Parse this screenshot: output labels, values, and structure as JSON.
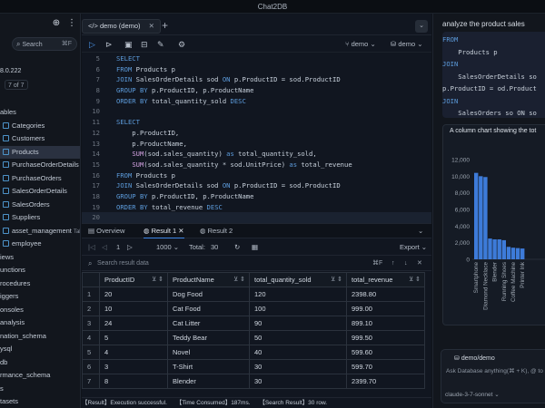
{
  "app": {
    "title": "Chat2DB"
  },
  "sidebar": {
    "search": {
      "placeholder": "Search",
      "shortcut": "⌘F"
    },
    "version": "8.0.222",
    "count": "7 of 7",
    "items": [
      {
        "label": "ables",
        "kind": "folder"
      },
      {
        "label": "Categories",
        "kind": "table"
      },
      {
        "label": "Customers",
        "kind": "table"
      },
      {
        "label": "Products",
        "kind": "table",
        "selected": true
      },
      {
        "label": "PurchaseOrderDetails",
        "kind": "table"
      },
      {
        "label": "PurchaseOrders",
        "kind": "table"
      },
      {
        "label": "SalesOrderDetails",
        "kind": "table"
      },
      {
        "label": "SalesOrders",
        "kind": "table"
      },
      {
        "label": "Suppliers",
        "kind": "table"
      },
      {
        "label": "asset_management",
        "kind": "table",
        "tag": "Tab"
      },
      {
        "label": "employee",
        "kind": "table"
      },
      {
        "label": "iews",
        "kind": "folder"
      },
      {
        "label": "unctions",
        "kind": "folder"
      },
      {
        "label": "rocedures",
        "kind": "folder"
      },
      {
        "label": "iggers",
        "kind": "folder"
      },
      {
        "label": "onsoles",
        "kind": "folder"
      },
      {
        "label": "analysis",
        "kind": "folder"
      },
      {
        "label": "nation_schema",
        "kind": "folder"
      },
      {
        "label": "ysql",
        "kind": "folder"
      },
      {
        "label": "db",
        "kind": "folder"
      },
      {
        "label": "rmance_schema",
        "kind": "folder"
      },
      {
        "label": "s",
        "kind": "folder"
      },
      {
        "label": "tasets",
        "kind": "folder"
      }
    ]
  },
  "editor": {
    "tab": {
      "label": "demo (demo)",
      "icon": "code-icon"
    },
    "toolbar": {
      "datasource": "demo",
      "database": "demo"
    },
    "lines": [
      {
        "n": "5",
        "tokens": [
          {
            "t": "SELECT",
            "c": "kw"
          }
        ]
      },
      {
        "n": "6",
        "tokens": [
          {
            "t": "FROM",
            "c": "kw"
          },
          {
            "t": " Products p",
            "c": ""
          }
        ]
      },
      {
        "n": "7",
        "tokens": [
          {
            "t": "JOIN",
            "c": "kw"
          },
          {
            "t": " SalesOrderDetails sod ",
            "c": ""
          },
          {
            "t": "ON",
            "c": "kw"
          },
          {
            "t": " p.ProductID = sod.ProductID",
            "c": ""
          }
        ]
      },
      {
        "n": "8",
        "tokens": [
          {
            "t": "GROUP BY",
            "c": "kw"
          },
          {
            "t": " p.ProductID, p.ProductName",
            "c": ""
          }
        ]
      },
      {
        "n": "9",
        "tokens": [
          {
            "t": "ORDER BY",
            "c": "kw"
          },
          {
            "t": " total_quantity_sold ",
            "c": ""
          },
          {
            "t": "DESC",
            "c": "kw"
          }
        ]
      },
      {
        "n": "10",
        "tokens": []
      },
      {
        "n": "11",
        "tokens": [
          {
            "t": "SELECT",
            "c": "kw"
          }
        ]
      },
      {
        "n": "12",
        "tokens": [
          {
            "t": "    p.ProductID,",
            "c": ""
          }
        ]
      },
      {
        "n": "13",
        "tokens": [
          {
            "t": "    p.ProductName,",
            "c": ""
          }
        ]
      },
      {
        "n": "14",
        "tokens": [
          {
            "t": "    ",
            "c": ""
          },
          {
            "t": "SUM",
            "c": "fn"
          },
          {
            "t": "(sod.sales_quantity) ",
            "c": ""
          },
          {
            "t": "as",
            "c": "kw"
          },
          {
            "t": " total_quantity_sold,",
            "c": ""
          }
        ]
      },
      {
        "n": "15",
        "tokens": [
          {
            "t": "    ",
            "c": ""
          },
          {
            "t": "SUM",
            "c": "fn"
          },
          {
            "t": "(sod.sales_quantity * sod.UnitPrice) ",
            "c": ""
          },
          {
            "t": "as",
            "c": "kw"
          },
          {
            "t": " total_revenue",
            "c": ""
          }
        ]
      },
      {
        "n": "16",
        "tokens": [
          {
            "t": "FROM",
            "c": "kw"
          },
          {
            "t": " Products p",
            "c": ""
          }
        ]
      },
      {
        "n": "17",
        "tokens": [
          {
            "t": "JOIN",
            "c": "kw"
          },
          {
            "t": " SalesOrderDetails sod ",
            "c": ""
          },
          {
            "t": "ON",
            "c": "kw"
          },
          {
            "t": " p.ProductID = sod.ProductID",
            "c": ""
          }
        ]
      },
      {
        "n": "18",
        "tokens": [
          {
            "t": "GROUP BY",
            "c": "kw"
          },
          {
            "t": " p.ProductID, p.ProductName",
            "c": ""
          }
        ]
      },
      {
        "n": "19",
        "tokens": [
          {
            "t": "ORDER BY",
            "c": "kw"
          },
          {
            "t": " total_revenue ",
            "c": ""
          },
          {
            "t": "DESC",
            "c": "kw"
          }
        ]
      },
      {
        "n": "20",
        "tokens": []
      }
    ]
  },
  "results": {
    "tabs": {
      "overview": "Overview",
      "result1": "Result 1",
      "result2": "Result 2"
    },
    "pager": {
      "page": "1",
      "page_size": "1000",
      "total_label": "Total:",
      "total": "30"
    },
    "search_placeholder": "Search result data",
    "search_shortcut": "⌘F",
    "columns": [
      "ProductID",
      "ProductName",
      "total_quantity_sold",
      "total_revenue"
    ],
    "rows": [
      {
        "idx": "1",
        "cells": [
          "20",
          "Dog Food",
          "120",
          "2398.80"
        ]
      },
      {
        "idx": "2",
        "cells": [
          "10",
          "Cat Food",
          "100",
          "999.00"
        ]
      },
      {
        "idx": "3",
        "cells": [
          "24",
          "Cat Litter",
          "90",
          "899.10"
        ]
      },
      {
        "idx": "4",
        "cells": [
          "5",
          "Teddy Bear",
          "50",
          "999.50"
        ]
      },
      {
        "idx": "5",
        "cells": [
          "4",
          "Novel",
          "40",
          "599.60"
        ]
      },
      {
        "idx": "6",
        "cells": [
          "3",
          "T-Shirt",
          "30",
          "599.70"
        ]
      },
      {
        "idx": "7",
        "cells": [
          "8",
          "Blender",
          "30",
          "2399.70"
        ]
      }
    ],
    "status": {
      "result": "【Result】Execution successful.",
      "time": "【Time Consumed】187ms.",
      "search": "【Search Result】30 row."
    }
  },
  "ai_panel": {
    "title": "analyze the product sales",
    "code_lines": [
      {
        "tokens": [
          {
            "t": "FROM",
            "c": "kw"
          }
        ]
      },
      {
        "tokens": [
          {
            "t": "    Products p",
            "c": ""
          }
        ]
      },
      {
        "tokens": [
          {
            "t": "JOIN",
            "c": "kw"
          }
        ]
      },
      {
        "tokens": [
          {
            "t": "    SalesOrderDetails so",
            "c": ""
          }
        ]
      },
      {
        "tokens": [
          {
            "t": "p.ProductID = od.Product",
            "c": ""
          }
        ]
      },
      {
        "tokens": [
          {
            "t": "JOIN",
            "c": "kw"
          }
        ]
      },
      {
        "tokens": [
          {
            "t": "    SalesOrders so ON so",
            "c": ""
          }
        ]
      }
    ],
    "chart_caption": "A column chart showing the tot",
    "input": {
      "db": "demo/demo",
      "placeholder": "Ask Database anything(⌘ + K), @ to s",
      "model": "claude-3-7-sonnet"
    }
  },
  "chart_data": {
    "type": "bar",
    "title": "A column chart showing the tot",
    "ylim": [
      0,
      12000
    ],
    "yticks": [
      0,
      2000,
      4000,
      6000,
      8000,
      10000,
      12000
    ],
    "categories": [
      "Smartphone",
      "",
      "Diamond Necklace",
      "",
      "Blender",
      "",
      "Running Shoes",
      "",
      "Coffee Machine",
      "",
      "Printer Ink"
    ],
    "values": [
      10400,
      10000,
      9900,
      2500,
      2400,
      2400,
      2300,
      1500,
      1400,
      1350,
      1300
    ],
    "color": "#3d7bd9"
  }
}
